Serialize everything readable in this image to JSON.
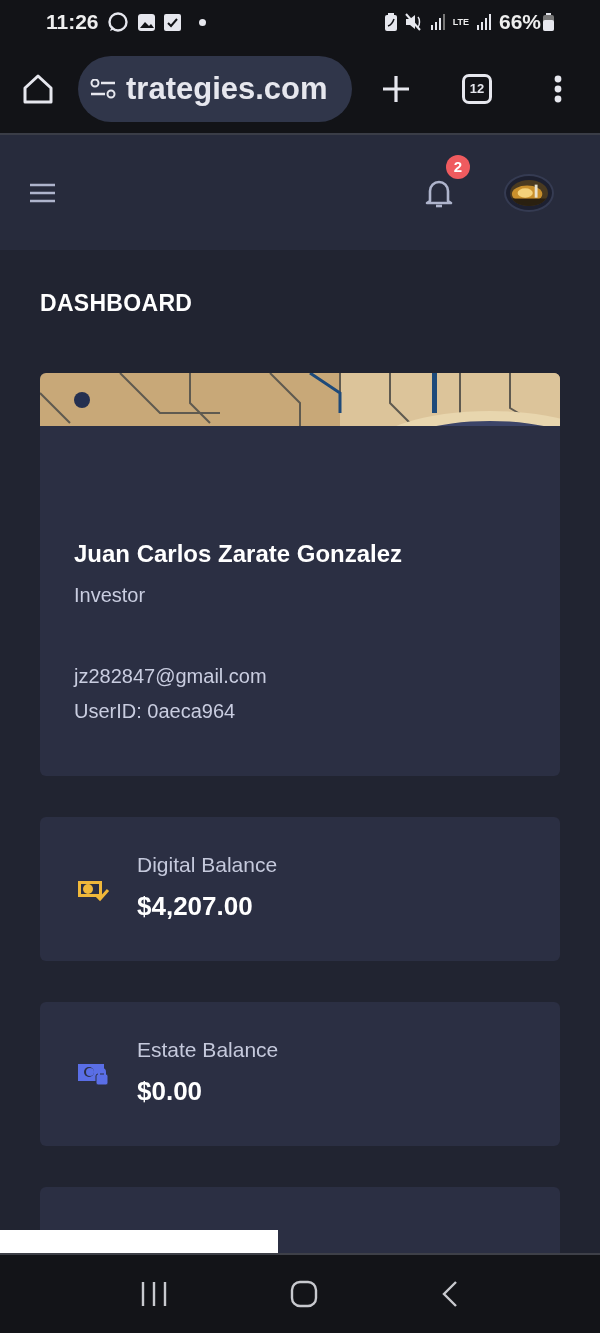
{
  "status_bar": {
    "time": "11:26",
    "network": "LTE",
    "battery": "66%"
  },
  "browser": {
    "url": "trategies.com",
    "tab_count": "12"
  },
  "header": {
    "notification_count": "2"
  },
  "page_title": "DASHBOARD",
  "profile": {
    "name": "Juan Carlos Zarate Gonzalez",
    "role": "Investor",
    "email": "jz282847@gmail.com",
    "user_id": "UserID: 0aeca964"
  },
  "balances": [
    {
      "label": "Digital Balance",
      "value": "$4,207.00",
      "kind": "verified"
    },
    {
      "label": "Estate Balance",
      "value": "$0.00",
      "kind": "locked"
    }
  ]
}
